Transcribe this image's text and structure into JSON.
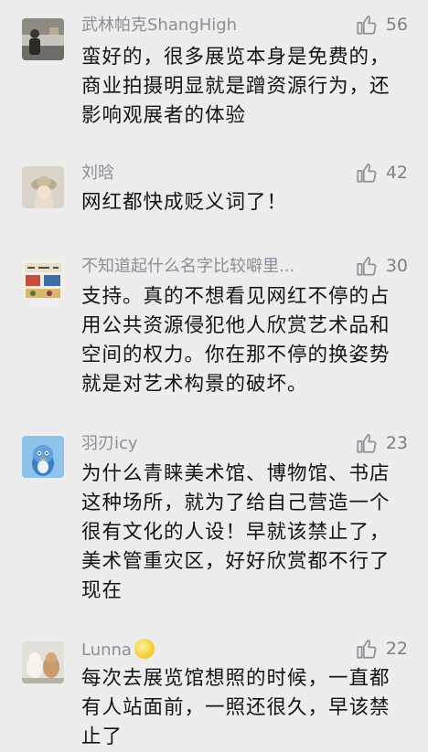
{
  "comments": [
    {
      "username": "武林帕克ShangHigh",
      "likes": "56",
      "text": [
        "蛮好的，很多展览本身是免费的，",
        "商业拍摄明显就是蹭资源行为，还",
        "影响观展者的体验"
      ]
    },
    {
      "username": "刘晗",
      "likes": "42",
      "text": [
        "网红都快成贬义词了！"
      ]
    },
    {
      "username": "不知道起什么名字比较噼里...",
      "likes": "30",
      "text": [
        "支持。真的不想看见网红不停的占",
        "用公共资源侵犯他人欣赏艺术品和",
        "空间的权力。你在那不停的换姿势",
        "就是对艺术构景的破坏。"
      ]
    },
    {
      "username": "羽刃icy",
      "likes": "23",
      "text": [
        "为什么青睐美术馆、博物馆、书店",
        "这种场所，就为了给自己营造一个",
        "很有文化的人设！早就该禁止了，",
        "美术管重灾区，好好欣赏都不行了",
        "现在"
      ]
    },
    {
      "username": "Lunna",
      "likes": "22",
      "text": [
        "每次去展览馆想照的时候，一直都",
        "有人站面前，一照还很久，早该禁",
        "止了"
      ]
    }
  ]
}
